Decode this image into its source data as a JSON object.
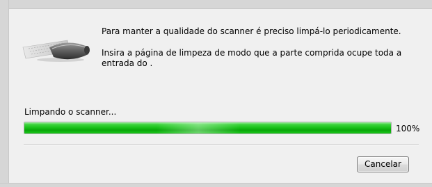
{
  "dialog": {
    "message_line1": "Para manter a qualidade do scanner é preciso limpá-lo periodicamente.",
    "message_line2": "Insira a página de limpeza de modo que a parte comprida ocupe toda a entrada do .",
    "illustration": "scanner-icon"
  },
  "progress": {
    "label": "Limpando o scanner...",
    "fraction": 1.0,
    "percent_text": "100%",
    "color": "#16c016"
  },
  "buttons": {
    "cancel_label": "Cancelar"
  }
}
